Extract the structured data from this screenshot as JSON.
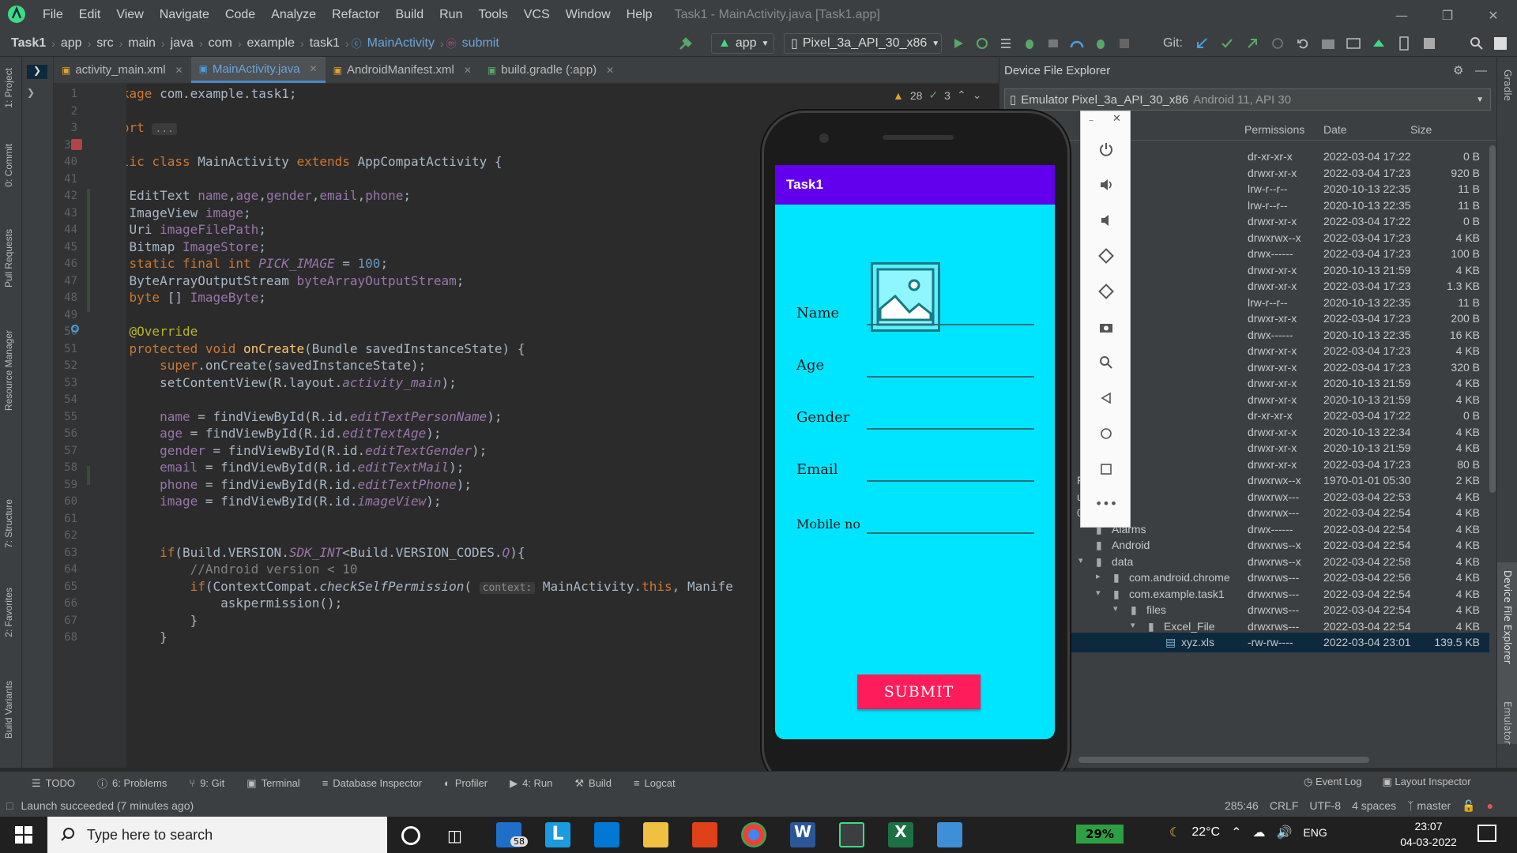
{
  "window": {
    "menu": [
      "File",
      "Edit",
      "View",
      "Navigate",
      "Code",
      "Analyze",
      "Refactor",
      "Build",
      "Run",
      "Tools",
      "VCS",
      "Window",
      "Help"
    ],
    "title": "Task1 - MainActivity.java [Task1.app]"
  },
  "breadcrumb": [
    "Task1",
    "app",
    "src",
    "main",
    "java",
    "com",
    "example",
    "task1",
    "MainActivity",
    "submit"
  ],
  "toolbar": {
    "run_config": "app",
    "device": "Pixel_3a_API_30_x86",
    "git_label": "Git:"
  },
  "tabs": [
    {
      "label": "activity_main.xml",
      "active": false
    },
    {
      "label": "MainActivity.java",
      "active": true
    },
    {
      "label": "AndroidManifest.xml",
      "active": false
    },
    {
      "label": "build.gradle (:app)",
      "active": false
    }
  ],
  "inspections": {
    "warnings": "28",
    "ok": "3"
  },
  "left_stripe": [
    "1: Project",
    "0: Commit",
    "Pull Requests",
    "Resource Manager",
    "7: Structure",
    "2: Favorites",
    "Build Variants"
  ],
  "right_stripe": [
    "Gradle",
    "Device File Explorer",
    "Emulator"
  ],
  "code_lines": [
    {
      "n": "1",
      "html": "<span class=\"kw\">package</span> com.example.task1;"
    },
    {
      "n": "2",
      "html": ""
    },
    {
      "n": "3",
      "html": "<span class=\"kw\">import</span> <span class=\"hint\">...</span>"
    },
    {
      "n": "39",
      "html": ""
    },
    {
      "n": "40",
      "html": "<span class=\"kw\">public class</span> MainActivity <span class=\"kw\">extends</span> AppCompatActivity {"
    },
    {
      "n": "41",
      "html": ""
    },
    {
      "n": "42",
      "html": "    EditText <span class=\"fld\">name</span>,<span class=\"fld\">age</span>,<span class=\"fld\">gender</span>,<span class=\"fld\">email</span>,<span class=\"fld\">phone</span>;"
    },
    {
      "n": "43",
      "html": "    ImageView <span class=\"fld\">image</span>;"
    },
    {
      "n": "44",
      "html": "    Uri <span class=\"fld\">imageFilePath</span>;"
    },
    {
      "n": "45",
      "html": "    Bitmap <span class=\"fld\">ImageStore</span>;"
    },
    {
      "n": "46",
      "html": "    <span class=\"kw\">static final int</span> <span class=\"fi\">PICK_IMAGE</span> = <span class=\"num\">100</span>;"
    },
    {
      "n": "47",
      "html": "    ByteArrayOutputStream <span class=\"fld\">byteArrayOutputStream</span>;"
    },
    {
      "n": "48",
      "html": "    <span class=\"kw\">byte</span> [] <span class=\"fld\">ImageByte</span>;"
    },
    {
      "n": "49",
      "html": ""
    },
    {
      "n": "50",
      "html": "    <span class=\"ann\">@Override</span>"
    },
    {
      "n": "51",
      "html": "    <span class=\"kw\">protected void</span> <span class=\"fn\">onCreate</span>(Bundle savedInstanceState) {"
    },
    {
      "n": "52",
      "html": "        <span class=\"kw\">super</span>.onCreate(savedInstanceState);"
    },
    {
      "n": "53",
      "html": "        setContentView(R.layout.<span class=\"fi\">activity_main</span>);"
    },
    {
      "n": "54",
      "html": ""
    },
    {
      "n": "55",
      "html": "        <span class=\"fld\">name</span> = findViewById(R.id.<span class=\"fi\">editTextPersonName</span>);"
    },
    {
      "n": "56",
      "html": "        <span class=\"fld\">age</span> = findViewById(R.id.<span class=\"fi\">editTextAge</span>);"
    },
    {
      "n": "57",
      "html": "        <span class=\"fld\">gender</span> = findViewById(R.id.<span class=\"fi\">editTextGender</span>);"
    },
    {
      "n": "58",
      "html": "        <span class=\"fld\">email</span> = findViewById(R.id.<span class=\"fi\">editTextMail</span>);"
    },
    {
      "n": "59",
      "html": "        <span class=\"fld\">phone</span> = findViewById(R.id.<span class=\"fi\">editTextPhone</span>);"
    },
    {
      "n": "60",
      "html": "        <span class=\"fld\">image</span> = findViewById(R.id.<span class=\"fi\">imageView</span>);"
    },
    {
      "n": "61",
      "html": ""
    },
    {
      "n": "62",
      "html": ""
    },
    {
      "n": "63",
      "html": "        <span class=\"kw\">if</span>(Build.VERSION.<span class=\"fi\">SDK_INT</span>&lt;Build.VERSION_CODES.<span class=\"fi\">Q</span>){"
    },
    {
      "n": "64",
      "html": "            <span class=\"cm\">//Android version &lt; 10</span>"
    },
    {
      "n": "65",
      "html": "            <span class=\"kw\">if</span>(ContextCompat.<span class=\"it\">checkSelfPermission</span>( <span class=\"hint\">context:</span> MainActivity.<span class=\"kw\">this</span>, Manife"
    },
    {
      "n": "66",
      "html": "                askpermission();"
    },
    {
      "n": "67",
      "html": "            }"
    },
    {
      "n": "68",
      "html": "        }"
    }
  ],
  "device_explorer": {
    "title": "Device File Explorer",
    "device": "Emulator Pixel_3a_API_30_x86",
    "device_meta": "Android 11, API 30",
    "columns": [
      "Permissions",
      "Date",
      "Size"
    ],
    "rows": [
      {
        "name": "",
        "perm": "dr-xr-xr-x",
        "date": "2022-03-04 17:22",
        "size": "0 B"
      },
      {
        "name": "",
        "perm": "drwxr-xr-x",
        "date": "2022-03-04 17:23",
        "size": "920 B"
      },
      {
        "name": "",
        "perm": "lrw-r--r--",
        "date": "2020-10-13 22:35",
        "size": "11 B"
      },
      {
        "name": "",
        "perm": "lrw-r--r--",
        "date": "2020-10-13 22:35",
        "size": "11 B"
      },
      {
        "name": "",
        "perm": "drwxr-xr-x",
        "date": "2022-03-04 17:22",
        "size": "0 B"
      },
      {
        "name": "",
        "perm": "drwxrwx--x",
        "date": "2022-03-04 17:23",
        "size": "4 KB"
      },
      {
        "name": "",
        "perm": "drwx------",
        "date": "2022-03-04 17:23",
        "size": "100 B"
      },
      {
        "name": "",
        "perm": "drwxr-xr-x",
        "date": "2020-10-13 21:59",
        "size": "4 KB"
      },
      {
        "name": "",
        "perm": "drwxr-xr-x",
        "date": "2022-03-04 17:23",
        "size": "1.3 KB"
      },
      {
        "name": "",
        "perm": "lrw-r--r--",
        "date": "2020-10-13 22:35",
        "size": "11 B"
      },
      {
        "name": "",
        "perm": "drwxr-xr-x",
        "date": "2022-03-04 17:23",
        "size": "200 B"
      },
      {
        "name": "",
        "perm": "drwx------",
        "date": "2020-10-13 22:35",
        "size": "16 KB"
      },
      {
        "name": "",
        "perm": "drwxr-xr-x",
        "date": "2022-03-04 17:23",
        "size": "4 KB"
      },
      {
        "name": "",
        "perm": "drwxr-xr-x",
        "date": "2022-03-04 17:23",
        "size": "320 B"
      },
      {
        "name": "",
        "perm": "drwxr-xr-x",
        "date": "2020-10-13 21:59",
        "size": "4 KB"
      },
      {
        "name": "",
        "perm": "drwxr-xr-x",
        "date": "2020-10-13 21:59",
        "size": "4 KB"
      },
      {
        "name": "",
        "perm": "dr-xr-xr-x",
        "date": "2022-03-04 17:22",
        "size": "0 B"
      },
      {
        "name": "",
        "perm": "drwxr-xr-x",
        "date": "2020-10-13 22:34",
        "size": "4 KB"
      },
      {
        "name": "",
        "perm": "drwxr-xr-x",
        "date": "2020-10-13 21:59",
        "size": "4 KB"
      },
      {
        "name": "",
        "perm": "drwxr-xr-x",
        "date": "2022-03-04 17:23",
        "size": "80 B"
      },
      {
        "name": "FC-0C05",
        "perm": "drwxrwx--x",
        "date": "1970-01-01 05:30",
        "size": "2 KB"
      },
      {
        "name": "ulated",
        "perm": "drwxrwx---",
        "date": "2022-03-04 22:53",
        "size": "4 KB"
      },
      {
        "name": "0",
        "perm": "drwxrwx---",
        "date": "2022-03-04 22:54",
        "size": "4 KB"
      },
      {
        "name": "Alarms",
        "perm": "drwx------",
        "date": "2022-03-04 22:54",
        "size": "4 KB",
        "indent": 1
      },
      {
        "name": "Android",
        "perm": "drwxrws--x",
        "date": "2022-03-04 22:54",
        "size": "4 KB",
        "indent": 1
      },
      {
        "name": "data",
        "perm": "drwxrws--x",
        "date": "2022-03-04 22:58",
        "size": "4 KB",
        "indent": 1,
        "open": true
      },
      {
        "name": "com.android.chrome",
        "perm": "drwxrws---",
        "date": "2022-03-04 22:56",
        "size": "4 KB",
        "indent": 2,
        "closed": true
      },
      {
        "name": "com.example.task1",
        "perm": "drwxrws---",
        "date": "2022-03-04 22:54",
        "size": "4 KB",
        "indent": 2,
        "open": true
      },
      {
        "name": "files",
        "perm": "drwxrws---",
        "date": "2022-03-04 22:54",
        "size": "4 KB",
        "indent": 3,
        "open": true
      },
      {
        "name": "Excel_File",
        "perm": "drwxrws---",
        "date": "2022-03-04 22:54",
        "size": "4 KB",
        "indent": 4,
        "open": true
      },
      {
        "name": "xyz.xls",
        "perm": "-rw-rw----",
        "date": "2022-03-04 23:01",
        "size": "139.5 KB",
        "indent": 5,
        "file": true,
        "selected": true
      }
    ]
  },
  "phone_app": {
    "title": "Task1",
    "fields": [
      "Name",
      "Age",
      "Gender",
      "Email",
      "Mobile no"
    ],
    "submit": "SUBMIT",
    "bg": "#00e5ff",
    "appbar": "#6200ee",
    "button": "#ff1c5a"
  },
  "bottom_tools": [
    "TODO",
    "6: Problems",
    "9: Git",
    "Terminal",
    "Database Inspector",
    "Profiler",
    "4: Run",
    "Build",
    "Logcat"
  ],
  "bottom_right_tools": [
    "Event Log",
    "Layout Inspector"
  ],
  "status": {
    "message": "Launch succeeded (7 minutes ago)",
    "position": "285:46",
    "line_sep": "CRLF",
    "encoding": "UTF-8",
    "indent": "4 spaces",
    "branch": "master"
  },
  "taskbar": {
    "search_placeholder": "Type here to search",
    "mail_badge": "58",
    "battery": "29%",
    "temperature": "22°C",
    "lang": "ENG",
    "time": "23:07",
    "date": "04-03-2022"
  }
}
